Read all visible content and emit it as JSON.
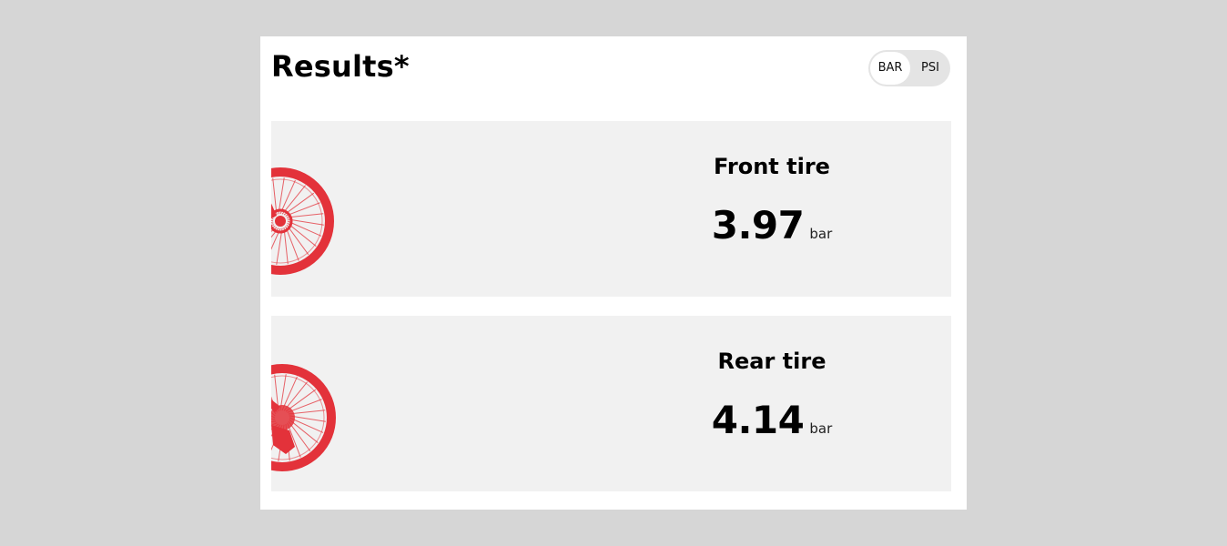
{
  "title": "Results*",
  "unit_toggle": {
    "options": [
      "BAR",
      "PSI"
    ],
    "selected": "BAR"
  },
  "tires": [
    {
      "label": "Front tire",
      "value": "3.97",
      "unit": "bar",
      "icon": "front-wheel-icon"
    },
    {
      "label": "Rear tire",
      "value": "4.14",
      "unit": "bar",
      "icon": "rear-wheel-icon"
    }
  ],
  "colors": {
    "accent": "#e3323a",
    "panel": "#f1f1f1",
    "background": "#d6d6d6"
  }
}
